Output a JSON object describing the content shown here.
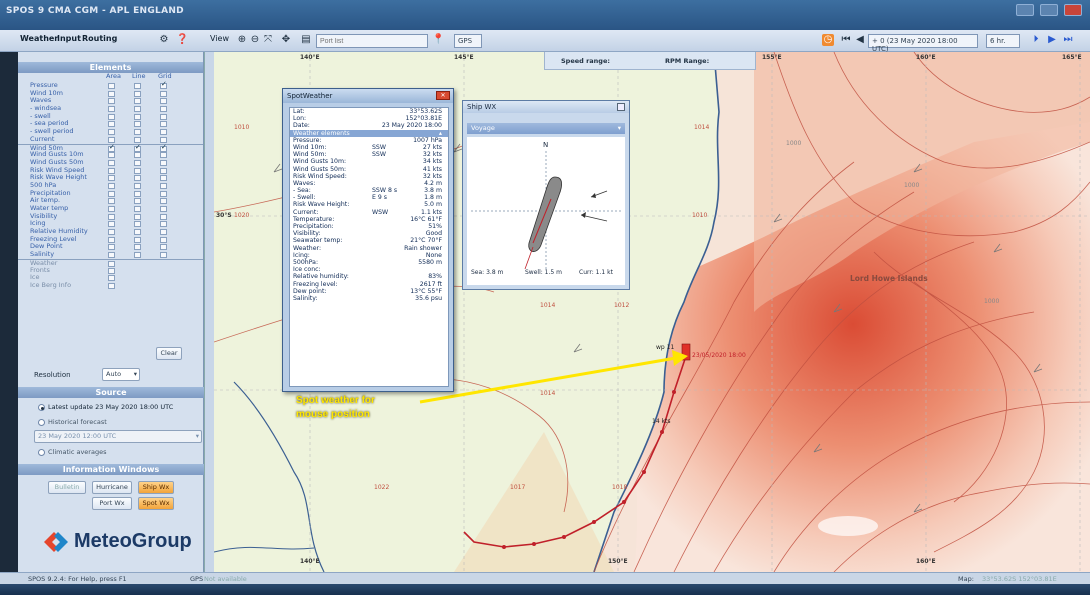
{
  "window": {
    "title": "SPOS 9 CMA CGM - APL ENGLAND"
  },
  "toolbar": {
    "tabs": [
      "Weather",
      "Input",
      "Routing"
    ],
    "view_label": "View",
    "port_placeholder": "Port list",
    "gps_label": "GPS",
    "time_value": "+ 0 (23 May 2020 18:00 UTC)",
    "step_value": "6 hr."
  },
  "legend_strip": {
    "speed_label": "Speed range:",
    "rpm_label": "RPM Range:"
  },
  "elements": {
    "heading": "Elements",
    "columns": [
      "Area",
      "Line",
      "Grid"
    ],
    "rows": [
      {
        "label": "Pressure",
        "area": false,
        "line": false,
        "grid": true
      },
      {
        "label": "Wind 10m",
        "area": false,
        "line": false,
        "grid": false
      },
      {
        "label": "Waves",
        "area": false,
        "line": false,
        "grid": false
      },
      {
        "label": "- windsea",
        "area": false,
        "line": false,
        "grid": false
      },
      {
        "label": "- swell",
        "area": false,
        "line": false,
        "grid": false
      },
      {
        "label": "- sea period",
        "area": false,
        "line": false,
        "grid": false
      },
      {
        "label": "- swell period",
        "area": false,
        "line": false,
        "grid": false
      },
      {
        "label": "Current",
        "area": false,
        "line": false,
        "grid": false
      },
      {
        "label": "Wind 50m",
        "area": true,
        "line": true,
        "grid": true
      },
      {
        "label": "Wind Gusts 10m",
        "area": false,
        "line": false,
        "grid": false
      },
      {
        "label": "Wind Gusts 50m",
        "area": false,
        "line": false,
        "grid": false
      },
      {
        "label": "Risk Wind Speed",
        "area": false,
        "line": false,
        "grid": false
      },
      {
        "label": "Risk Wave Height",
        "area": false,
        "line": false,
        "grid": false
      },
      {
        "label": "500 hPa",
        "area": false,
        "line": false,
        "grid": false
      },
      {
        "label": "Precipitation",
        "area": false,
        "line": false,
        "grid": false
      },
      {
        "label": "Air temp.",
        "area": false,
        "line": false,
        "grid": false
      },
      {
        "label": "Water temp",
        "area": false,
        "line": false,
        "grid": false
      },
      {
        "label": "Visibility",
        "area": false,
        "line": false,
        "grid": false
      },
      {
        "label": "Icing",
        "area": false,
        "line": false,
        "grid": false
      },
      {
        "label": "Relative Humidity",
        "area": false,
        "line": false,
        "grid": false
      },
      {
        "label": "Freezing Level",
        "area": false,
        "line": false,
        "grid": false
      },
      {
        "label": "Dew Point",
        "area": false,
        "line": false,
        "grid": false
      },
      {
        "label": "Salinity",
        "area": false,
        "line": false,
        "grid": false
      },
      {
        "label": "Weather",
        "area": false,
        "line": false,
        "grid": false
      },
      {
        "label": "Fronts",
        "area": false,
        "line": false,
        "grid": false
      },
      {
        "label": "Ice",
        "area": false,
        "line": false,
        "grid": false
      },
      {
        "label": "Ice Berg Info",
        "area": false,
        "line": false,
        "grid": false
      }
    ],
    "clear_label": "Clear",
    "resolution_label": "Resolution",
    "resolution_value": "Auto"
  },
  "source": {
    "heading": "Source",
    "latest": "Latest update 23 May 2020 18:00 UTC",
    "historical": "Historical forecast",
    "historical_value": "23 May 2020 12:00 UTC",
    "climatic": "Climatic averages"
  },
  "info_windows": {
    "heading": "Information Windows",
    "bulletin": "Bulletin",
    "hurricane": "Hurricane",
    "ship_wx": "Ship Wx",
    "port_wx": "Port Wx",
    "spot_wx": "Spot Wx"
  },
  "brand": {
    "name": "MeteoGroup"
  },
  "spot_weather": {
    "title": "SpotWeather",
    "lat_label": "Lat:",
    "lat": "33°53.62S",
    "lon_label": "Lon:",
    "lon": "152°03.81E",
    "date_label": "Date:",
    "date": "23 May 2020 18:00",
    "section": "Weather elements",
    "rows": [
      {
        "label": "Pressure:",
        "dir": "",
        "value": "1007 hPa"
      },
      {
        "label": "Wind 10m:",
        "dir": "SSW",
        "value": "27 kts"
      },
      {
        "label": "Wind 50m:",
        "dir": "SSW",
        "value": "32 kts"
      },
      {
        "label": "Wind Gusts 10m:",
        "dir": "",
        "value": "34 kts"
      },
      {
        "label": "Wind Gusts 50m:",
        "dir": "",
        "value": "41 kts"
      },
      {
        "label": "Risk Wind Speed:",
        "dir": "",
        "value": "32 kts"
      },
      {
        "label": "Waves:",
        "dir": "",
        "value": "4.2 m"
      },
      {
        "label": "- Sea:",
        "dir": "SSW   8 s",
        "value": "3.8 m"
      },
      {
        "label": "- Swell:",
        "dir": "E   9 s",
        "value": "1.8 m"
      },
      {
        "label": "Risk Wave Height:",
        "dir": "",
        "value": "5.0 m"
      },
      {
        "label": "Current:",
        "dir": "WSW",
        "value": "1.1 kts"
      },
      {
        "label": "Temperature:",
        "dir": "",
        "value": "16°C 61°F"
      },
      {
        "label": "Precipitation:",
        "dir": "",
        "value": "51%"
      },
      {
        "label": "Visibility:",
        "dir": "",
        "value": "Good"
      },
      {
        "label": "Seawater temp:",
        "dir": "",
        "value": "21°C 70°F"
      },
      {
        "label": "Weather:",
        "dir": "",
        "value": "Rain shower"
      },
      {
        "label": "Icing:",
        "dir": "",
        "value": "None"
      },
      {
        "label": "500hPa:",
        "dir": "",
        "value": "5580 m"
      },
      {
        "label": "Ice conc:",
        "dir": "",
        "value": ""
      },
      {
        "label": "Relative humidity:",
        "dir": "",
        "value": "83%"
      },
      {
        "label": "Freezing level:",
        "dir": "",
        "value": "2617 ft"
      },
      {
        "label": "Dew point:",
        "dir": "",
        "value": "13°C 55°F"
      },
      {
        "label": "Salinity:",
        "dir": "",
        "value": "35.6 psu"
      }
    ]
  },
  "ship_wx": {
    "title": "Ship WX",
    "mode": "Voyage",
    "north": "N",
    "sea": "Sea: 3.8 m",
    "swell": "Swell: 1.5 m",
    "curr": "Curr: 1.1 kt"
  },
  "map": {
    "lon_labels": [
      "140°E",
      "145°E",
      "150°E",
      "155°E",
      "160°E",
      "165°E"
    ],
    "lat_label": "30°S",
    "place": "Lord Howe Islands",
    "isobars": [
      "1000",
      "1010",
      "1020",
      "1014",
      "1012",
      "1022",
      "1017",
      "1018"
    ],
    "speed_label": "14 kts",
    "ship_label": "wp 11",
    "ship_time": "23/05/2020 18:00"
  },
  "annotation": {
    "line1": "Spot weather for",
    "line2": "mouse position"
  },
  "status": {
    "left": "SPOS 9.2.4: For Help, press F1",
    "gps": "GPS",
    "gps_value": "Not available",
    "map_label": "Map:",
    "map_value": "33°53.62S 152°03.81E"
  },
  "colors": {
    "accent": "#e04a30",
    "highlight": "#ffe600",
    "panel": "#d5e0ee"
  }
}
